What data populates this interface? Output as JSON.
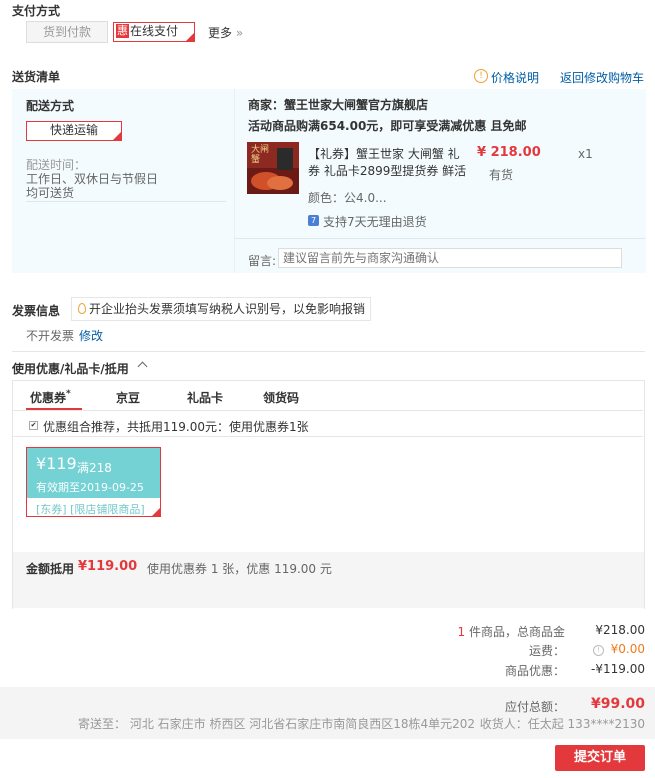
{
  "payment": {
    "title": "支付方式",
    "cod_label": "货到付款",
    "hui_badge": "惠",
    "online_label": "在线支付",
    "more_label": "更多",
    "more_arrow": "»"
  },
  "delivery": {
    "title": "送货清单",
    "price_info_label": "价格说明",
    "back_to_cart_label": "返回修改购物车",
    "method_label": "配送方式",
    "method_value": "快递运输",
    "time_label": "配送时间：",
    "time_value_1": "工作日、双休日与节假日",
    "time_value_2": "均可送货",
    "shop": "商家：蟹王世家大闸蟹官方旗舰店",
    "promo": "活动商品购满654.00元，即可享受满减优惠 且免邮",
    "product_title_1": "【礼券】蟹王世家 大闸蟹 礼",
    "product_title_2": "券 礼品卡2899型提货券 鲜活",
    "product_thumb_text": "大闸蟹",
    "price": "¥ 218.00",
    "qty": "x1",
    "stock": "有货",
    "color_label": "颜色：公4.0...",
    "return_badge": "7",
    "return_text": "支持7天无理由退货",
    "note_label": "留言:",
    "note_placeholder": "建议留言前先与商家沟通确认"
  },
  "invoice": {
    "title": "发票信息",
    "tip": "开企业抬头发票须填写纳税人识别号，以免影响报销",
    "status": "不开发票",
    "edit_label": "修改"
  },
  "discount": {
    "title": "使用优惠/礼品卡/抵用",
    "chevron": "^",
    "tabs": [
      "优惠券",
      "京豆",
      "礼品卡",
      "领货码"
    ],
    "active_tab_mark": "*",
    "recommend_text": "优惠组合推荐，共抵用119.00元：使用优惠券1张",
    "coupon_amount": "¥119",
    "coupon_condition": "满218",
    "coupon_expiry": "有效期至2019-09-25",
    "coupon_tags": "[东券] [限店铺限商品]",
    "total_label": "金额抵用",
    "total_value": "¥119.00",
    "summary": "使用优惠券 1 张，优惠 119.00 元"
  },
  "totals": {
    "count": "1",
    "count_text": "件商品，总商品金",
    "goods_amount": "¥218.00",
    "shipping_label": "运费：",
    "shipping_amount": "¥0.00",
    "discount_label": "商品优惠：",
    "discount_amount": "-¥119.00"
  },
  "footer": {
    "payable_label": "应付总额：",
    "payable_amount": "¥99.00",
    "address": "寄送至： 河北 石家庄市 桥西区 河北省石家庄市南简良西区18栋4单元202",
    "receiver": "收货人：任太起 133****2130",
    "submit_label": "提交订单"
  },
  "colors": {
    "accent": "#e4393c",
    "link": "#005ea7",
    "panel": "#f3fbfe",
    "coupon": "#74d2d4"
  }
}
